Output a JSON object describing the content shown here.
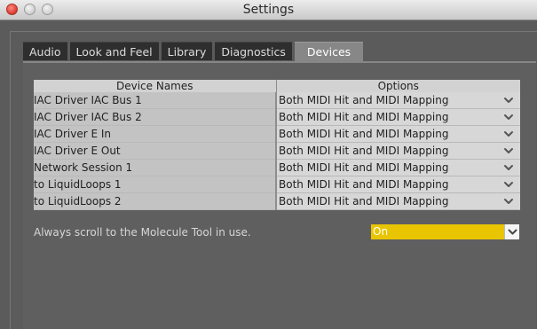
{
  "window": {
    "title": "Settings"
  },
  "tabs": [
    {
      "label": "Audio"
    },
    {
      "label": "Look and Feel"
    },
    {
      "label": "Library"
    },
    {
      "label": "Diagnostics"
    },
    {
      "label": "Devices",
      "active": true
    }
  ],
  "devices": {
    "columns": {
      "names": "Device Names",
      "options": "Options"
    },
    "rows": [
      {
        "name": "IAC Driver IAC Bus 1",
        "option": "Both MIDI Hit and MIDI Mapping"
      },
      {
        "name": "IAC Driver IAC Bus 2",
        "option": "Both MIDI Hit and MIDI Mapping"
      },
      {
        "name": "IAC Driver E In",
        "option": "Both MIDI Hit and MIDI Mapping"
      },
      {
        "name": "IAC Driver E Out",
        "option": "Both MIDI Hit and MIDI Mapping"
      },
      {
        "name": "Network Session 1",
        "option": "Both MIDI Hit and MIDI Mapping"
      },
      {
        "name": "to LiquidLoops 1",
        "option": "Both MIDI Hit and MIDI Mapping"
      },
      {
        "name": "to LiquidLoops 2",
        "option": "Both MIDI Hit and MIDI Mapping"
      }
    ]
  },
  "scroll_setting": {
    "label": "Always scroll to the Molecule Tool in use.",
    "value": "On"
  },
  "icons": {
    "close": "close-icon",
    "minimize": "minimize-icon",
    "zoom": "zoom-icon",
    "dropdown": "chevron-down-icon"
  },
  "colors": {
    "window_bg": "#5b5b5b",
    "active_tab": "#878787",
    "inactive_tab": "#2e2e2e",
    "highlight_select": "#e8c500"
  }
}
